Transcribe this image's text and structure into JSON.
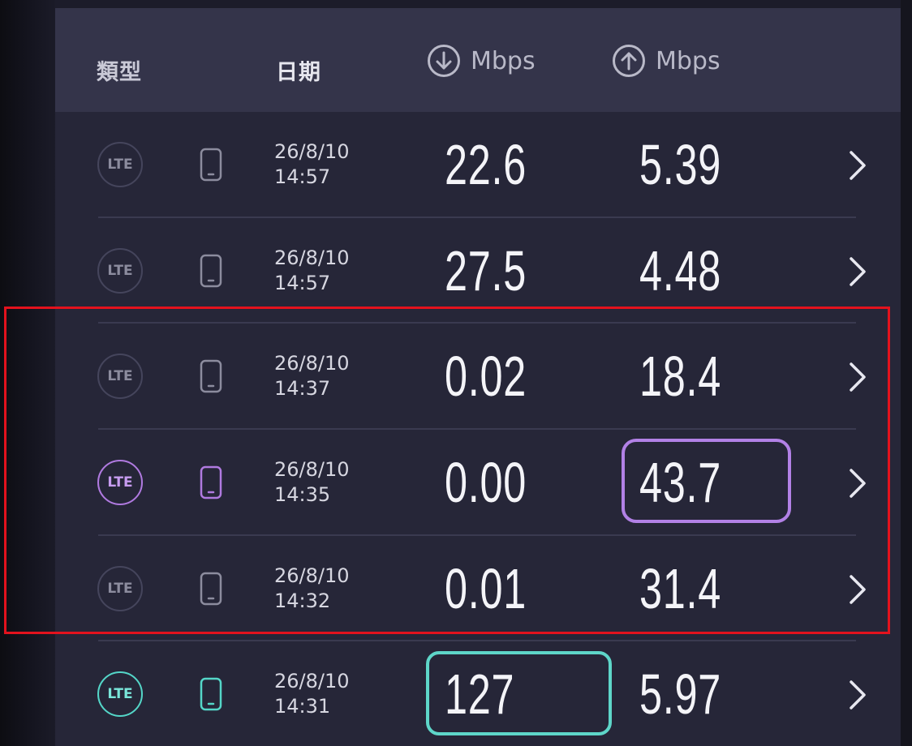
{
  "header": {
    "type_label": "類型",
    "date_label": "日期",
    "download_unit": "Mbps",
    "upload_unit": "Mbps"
  },
  "rows": [
    {
      "network": "LTE",
      "date": "26/8/10",
      "time": "14:57",
      "download": "22.6",
      "upload": "5.39",
      "highlight": "none"
    },
    {
      "network": "LTE",
      "date": "26/8/10",
      "time": "14:57",
      "download": "27.5",
      "upload": "4.48",
      "highlight": "none"
    },
    {
      "network": "LTE",
      "date": "26/8/10",
      "time": "14:37",
      "download": "0.02",
      "upload": "18.4",
      "highlight": "none"
    },
    {
      "network": "LTE",
      "date": "26/8/10",
      "time": "14:35",
      "download": "0.00",
      "upload": "43.7",
      "highlight": "purple"
    },
    {
      "network": "LTE",
      "date": "26/8/10",
      "time": "14:32",
      "download": "0.01",
      "upload": "31.4",
      "highlight": "none"
    },
    {
      "network": "LTE",
      "date": "26/8/10",
      "time": "14:31",
      "download": "127",
      "upload": "5.97",
      "highlight": "teal"
    }
  ],
  "colors": {
    "panel": "#262638",
    "header": "#34344a",
    "purple_accent": "#b281e6",
    "teal_accent": "#5ed6c9",
    "red_frame": "#e3121d"
  },
  "icons": {
    "download": "arrow-down-circle-icon",
    "upload": "arrow-up-circle-icon",
    "device": "phone-icon",
    "open": "chevron-right-icon"
  }
}
